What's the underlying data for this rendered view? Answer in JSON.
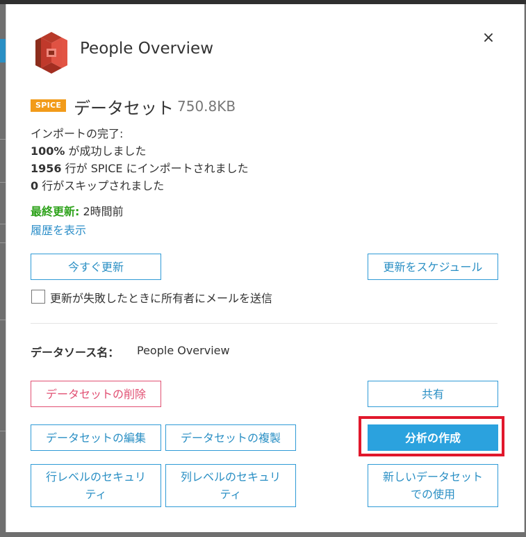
{
  "modal": {
    "title": "People Overview",
    "close_symbol": "×"
  },
  "dataset": {
    "badge": "SPICE",
    "label": "データセット",
    "size": "750.8KB"
  },
  "import": {
    "heading": "インポートの完了:",
    "success_pct": "100%",
    "success_text": " が成功しました",
    "rows_count": "1956",
    "rows_text": " 行が SPICE にインポートされました",
    "skipped_count": "0",
    "skipped_text": " 行がスキップされました"
  },
  "refresh": {
    "last_label": "最終更新:",
    "last_value": " 2時間前",
    "history_link": "履歴を表示",
    "now_button": "今すぐ更新",
    "schedule_button": "更新をスケジュール",
    "email_checkbox_label": "更新が失敗したときに所有者にメールを送信",
    "email_checked": false
  },
  "datasource": {
    "key": "データソース名：",
    "value": "People Overview"
  },
  "actions": {
    "delete": "データセットの削除",
    "share": "共有",
    "edit": "データセットの編集",
    "duplicate": "データセットの複製",
    "create_analysis": "分析の作成",
    "row_security_1": "行レベルのセキュリ",
    "row_security_2": "ティ",
    "col_security_1": "列レベルのセキュリ",
    "col_security_2": "ティ",
    "use_new_1": "新しいデータセット",
    "use_new_2": "での使用"
  },
  "icons": {
    "logo": "aws-s3-bucket-icon",
    "close": "close-icon",
    "checkbox": "checkbox-icon"
  },
  "colors": {
    "primary": "#2ba2de",
    "badge": "#f29b1a",
    "danger": "#e14f72",
    "success": "#2fa31c",
    "highlight": "#e1182c"
  }
}
